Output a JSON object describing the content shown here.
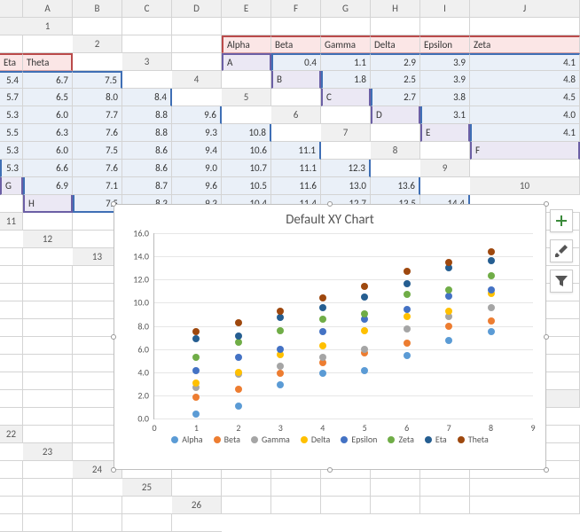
{
  "columns": [
    "A",
    "B",
    "C",
    "D",
    "E",
    "F",
    "G",
    "H",
    "I",
    "J"
  ],
  "row_count": 26,
  "table": {
    "headers": [
      "Alpha",
      "Beta",
      "Gamma",
      "Delta",
      "Epsilon",
      "Zeta",
      "Eta",
      "Theta"
    ],
    "row_labels": [
      "A",
      "B",
      "C",
      "D",
      "E",
      "F",
      "G",
      "H"
    ],
    "data": [
      [
        0.4,
        1.1,
        2.9,
        3.9,
        4.1,
        5.4,
        6.7,
        7.5
      ],
      [
        1.8,
        2.5,
        3.9,
        4.8,
        5.7,
        6.5,
        8.0,
        8.4
      ],
      [
        2.7,
        3.8,
        4.5,
        5.3,
        6.0,
        7.7,
        8.8,
        9.6
      ],
      [
        3.1,
        4.0,
        5.5,
        6.3,
        7.6,
        8.8,
        9.3,
        10.8
      ],
      [
        4.1,
        5.3,
        6.0,
        7.5,
        8.6,
        9.4,
        10.6,
        11.1
      ],
      [
        5.3,
        6.6,
        7.6,
        8.6,
        9.0,
        10.7,
        11.1,
        12.3
      ],
      [
        6.9,
        7.1,
        8.7,
        9.6,
        10.5,
        11.6,
        13.0,
        13.6
      ],
      [
        7.5,
        8.3,
        9.3,
        10.4,
        11.4,
        12.7,
        13.5,
        14.4
      ]
    ]
  },
  "chart": {
    "title": "Default XY Chart"
  },
  "chart_data": {
    "type": "scatter",
    "title": "Default XY Chart",
    "x": [
      1,
      2,
      3,
      4,
      5,
      6,
      7,
      8
    ],
    "xlim": [
      0,
      9
    ],
    "ylim": [
      0,
      16
    ],
    "ytick_step": 2.0,
    "xtick_step": 1,
    "xlabel": "",
    "ylabel": "",
    "series": [
      {
        "name": "Alpha",
        "color": "#5B9BD5",
        "values": [
          0.4,
          1.1,
          2.9,
          3.9,
          4.1,
          5.4,
          6.7,
          7.5
        ]
      },
      {
        "name": "Beta",
        "color": "#ED7D31",
        "values": [
          1.8,
          2.5,
          3.9,
          4.8,
          5.7,
          6.5,
          8.0,
          8.4
        ]
      },
      {
        "name": "Gamma",
        "color": "#A5A5A5",
        "values": [
          2.7,
          3.8,
          4.5,
          5.3,
          6.0,
          7.7,
          8.8,
          9.6
        ]
      },
      {
        "name": "Delta",
        "color": "#FFC000",
        "values": [
          3.1,
          4.0,
          5.5,
          6.3,
          7.6,
          8.8,
          9.3,
          10.8
        ]
      },
      {
        "name": "Epsilon",
        "color": "#4472C4",
        "values": [
          4.1,
          5.3,
          6.0,
          7.5,
          8.6,
          9.4,
          10.6,
          11.1
        ]
      },
      {
        "name": "Zeta",
        "color": "#70AD47",
        "values": [
          5.3,
          6.6,
          7.6,
          8.6,
          9.0,
          10.7,
          11.1,
          12.3
        ]
      },
      {
        "name": "Eta",
        "color": "#255E91",
        "values": [
          6.9,
          7.1,
          8.7,
          9.6,
          10.5,
          11.6,
          13.0,
          13.6
        ]
      },
      {
        "name": "Theta",
        "color": "#9E480E",
        "values": [
          7.5,
          8.3,
          9.3,
          10.4,
          11.4,
          12.7,
          13.5,
          14.4
        ]
      }
    ]
  },
  "flyout": {
    "plus_tooltip": "Chart Elements",
    "brush_tooltip": "Chart Styles",
    "filter_tooltip": "Chart Filters"
  }
}
